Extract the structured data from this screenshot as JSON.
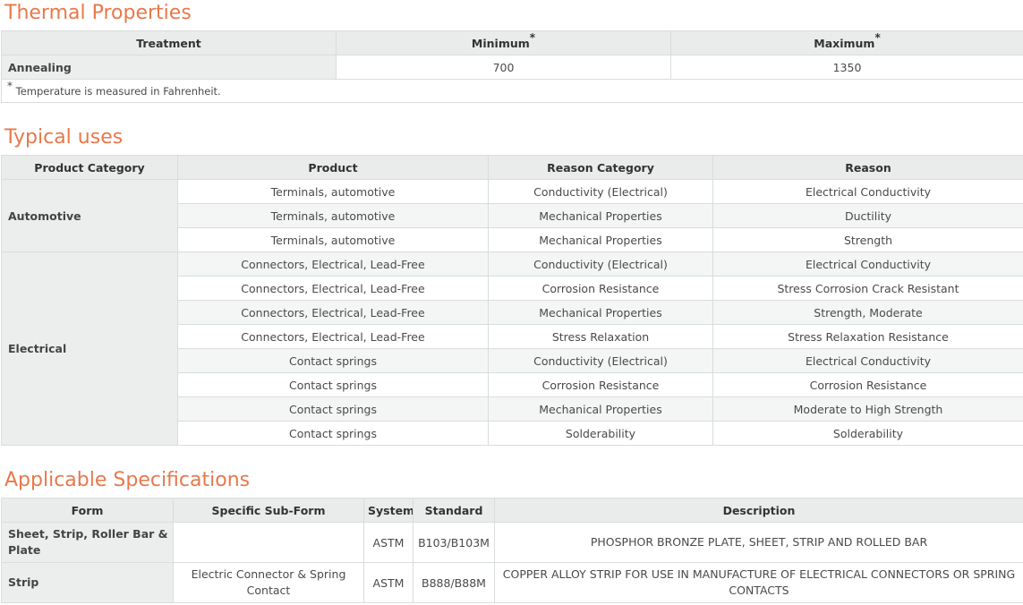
{
  "thermal": {
    "title": "Thermal Properties",
    "headers": {
      "treatment": "Treatment",
      "minimum": "Minimum",
      "maximum": "Maximum",
      "marker": "*"
    },
    "rows": [
      {
        "treatment": "Annealing",
        "minimum": "700",
        "maximum": "1350"
      }
    ],
    "note_marker": "*",
    "note": "Temperature is measured in Fahrenheit."
  },
  "typical": {
    "title": "Typical uses",
    "headers": [
      "Product Category",
      "Product",
      "Reason Category",
      "Reason"
    ],
    "groups": [
      {
        "category": "Automotive",
        "rows": [
          {
            "product": "Terminals, automotive",
            "reason_category": "Conductivity (Electrical)",
            "reason": "Electrical Conductivity"
          },
          {
            "product": "Terminals, automotive",
            "reason_category": "Mechanical Properties",
            "reason": "Ductility"
          },
          {
            "product": "Terminals, automotive",
            "reason_category": "Mechanical Properties",
            "reason": "Strength"
          }
        ]
      },
      {
        "category": "Electrical",
        "rows": [
          {
            "product": "Connectors, Electrical, Lead-Free",
            "reason_category": "Conductivity (Electrical)",
            "reason": "Electrical Conductivity"
          },
          {
            "product": "Connectors, Electrical, Lead-Free",
            "reason_category": "Corrosion Resistance",
            "reason": "Stress Corrosion Crack Resistant"
          },
          {
            "product": "Connectors, Electrical, Lead-Free",
            "reason_category": "Mechanical Properties",
            "reason": "Strength, Moderate"
          },
          {
            "product": "Connectors, Electrical, Lead-Free",
            "reason_category": "Stress Relaxation",
            "reason": "Stress Relaxation Resistance"
          },
          {
            "product": "Contact springs",
            "reason_category": "Conductivity (Electrical)",
            "reason": "Electrical Conductivity"
          },
          {
            "product": "Contact springs",
            "reason_category": "Corrosion Resistance",
            "reason": "Corrosion Resistance"
          },
          {
            "product": "Contact springs",
            "reason_category": "Mechanical Properties",
            "reason": "Moderate to High Strength"
          },
          {
            "product": "Contact springs",
            "reason_category": "Solderability",
            "reason": "Solderability"
          }
        ]
      }
    ]
  },
  "specs": {
    "title": "Applicable Specifications",
    "headers": [
      "Form",
      "Specific Sub-Form",
      "System",
      "Standard",
      "Description"
    ],
    "rows": [
      {
        "form": "Sheet, Strip, Roller Bar & Plate",
        "sub_form": "",
        "system": "ASTM",
        "standard": "B103/B103M",
        "description": "PHOSPHOR BRONZE PLATE, SHEET, STRIP AND ROLLED BAR"
      },
      {
        "form": "Strip",
        "sub_form": "Electric Connector & Spring Contact",
        "system": "ASTM",
        "standard": "B888/B88M",
        "description": "COPPER ALLOY STRIP FOR USE IN MANUFACTURE OF ELECTRICAL CONNECTORS OR SPRING CONTACTS"
      }
    ]
  }
}
